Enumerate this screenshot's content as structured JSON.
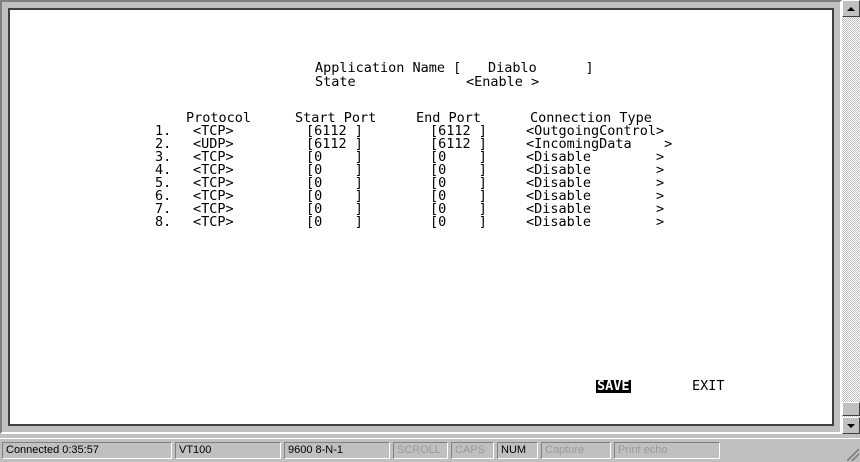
{
  "terminal": {
    "app_name_label": "Application Name [",
    "app_name_value": "Diablo      ]",
    "state_label": "State",
    "state_value": "<Enable >",
    "headers": {
      "protocol": "Protocol",
      "start_port": "Start Port",
      "end_port": "End Port",
      "connection_type": "Connection Type"
    },
    "rows": [
      {
        "num": "1.",
        "protocol": "<TCP>",
        "start": "[6112 ]",
        "end": "[6112 ]",
        "conn": "<OutgoingControl>"
      },
      {
        "num": "2.",
        "protocol": "<UDP>",
        "start": "[6112 ]",
        "end": "[6112 ]",
        "conn": "<IncomingData    >"
      },
      {
        "num": "3.",
        "protocol": "<TCP>",
        "start": "[0    ]",
        "end": "[0    ]",
        "conn": "<Disable        >"
      },
      {
        "num": "4.",
        "protocol": "<TCP>",
        "start": "[0    ]",
        "end": "[0    ]",
        "conn": "<Disable        >"
      },
      {
        "num": "5.",
        "protocol": "<TCP>",
        "start": "[0    ]",
        "end": "[0    ]",
        "conn": "<Disable        >"
      },
      {
        "num": "6.",
        "protocol": "<TCP>",
        "start": "[0    ]",
        "end": "[0    ]",
        "conn": "<Disable        >"
      },
      {
        "num": "7.",
        "protocol": "<TCP>",
        "start": "[0    ]",
        "end": "[0    ]",
        "conn": "<Disable        >"
      },
      {
        "num": "8.",
        "protocol": "<TCP>",
        "start": "[0    ]",
        "end": "[0    ]",
        "conn": "<Disable        >"
      }
    ],
    "save_label": "SAVE",
    "exit_label": "EXIT"
  },
  "statusbar": {
    "connected": "Connected 0:35:57",
    "emulation": "VT100",
    "port_settings": "9600 8-N-1",
    "scroll": "SCROLL",
    "caps": "CAPS",
    "num": "NUM",
    "capture": "Capture",
    "print_echo": "Print echo"
  }
}
